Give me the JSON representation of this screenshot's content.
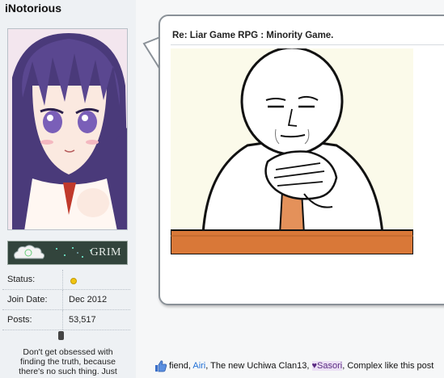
{
  "user": {
    "name": "iNotorious",
    "rank": "GRIM",
    "stats": [
      {
        "label": "Status:",
        "value": ""
      },
      {
        "label": "Join Date:",
        "value": "Dec 2012"
      },
      {
        "label": "Posts:",
        "value": "53,517"
      }
    ],
    "signature": "Don't get obsessed with finding the truth, because there's no such thing. Just"
  },
  "post": {
    "title": "Re: Liar Game RPG : Minority Game."
  },
  "likes": {
    "prefix": "fiend, ",
    "user1": "Airi",
    "mid": ", The new Uchiwa Clan13, ",
    "user2": "♥Sasori",
    "suffix": ", Complex like this post"
  },
  "colors": {
    "status_online": "#f1c40f",
    "link_blue": "#1f6fd6",
    "meme_background": "#fbfaea",
    "table_wood": "#d97838"
  },
  "icons": [
    "cloud-emblem-icon",
    "status-dot-icon",
    "thumbs-up-icon"
  ]
}
